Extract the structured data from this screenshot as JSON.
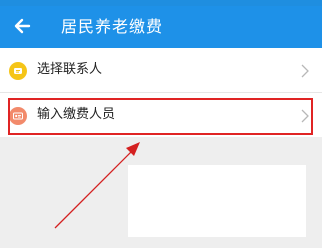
{
  "header": {
    "title": "居民养老缴费",
    "back_icon": "back-arrow-icon",
    "background": "#1e91e8"
  },
  "list": {
    "items": [
      {
        "label": "选择联系人",
        "icon": "contact-icon",
        "icon_color": "#f5c518"
      },
      {
        "label": "输入缴费人员",
        "icon": "id-card-icon",
        "icon_color": "#f28a6b"
      }
    ],
    "chevron_icon": "chevron-right-icon"
  },
  "annotation": {
    "highlight_color": "#e02424",
    "arrow_color": "#d42020"
  }
}
